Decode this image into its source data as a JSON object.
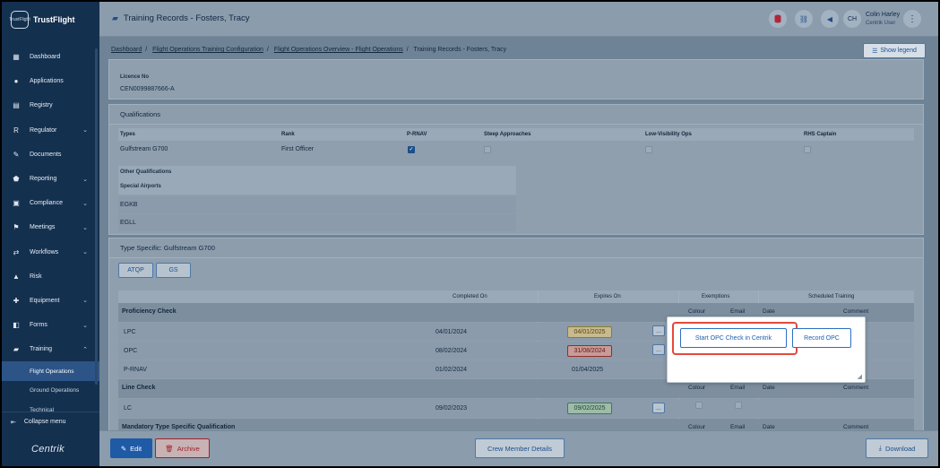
{
  "brand": {
    "name": "TrustFlight",
    "logo_text": "TrustFlight"
  },
  "sidebar": {
    "items": [
      {
        "label": "Dashboard",
        "icon": "dashboard-icon",
        "glyph": "▦",
        "chevron": false
      },
      {
        "label": "Applications",
        "icon": "user-icon",
        "glyph": "●",
        "chevron": false
      },
      {
        "label": "Registry",
        "icon": "book-icon",
        "glyph": "▤",
        "chevron": false
      },
      {
        "label": "Regulator",
        "icon": "regulator-icon",
        "glyph": "R",
        "chevron": true
      },
      {
        "label": "Documents",
        "icon": "paperclip-icon",
        "glyph": "✎",
        "chevron": false
      },
      {
        "label": "Reporting",
        "icon": "shield-icon",
        "glyph": "⬟",
        "chevron": true
      },
      {
        "label": "Compliance",
        "icon": "clipboard-icon",
        "glyph": "▣",
        "chevron": true
      },
      {
        "label": "Meetings",
        "icon": "meetings-icon",
        "glyph": "⚑",
        "chevron": true
      },
      {
        "label": "Workflows",
        "icon": "workflow-icon",
        "glyph": "⇄",
        "chevron": true
      },
      {
        "label": "Risk",
        "icon": "warning-icon",
        "glyph": "▲",
        "chevron": false
      },
      {
        "label": "Equipment",
        "icon": "wrench-icon",
        "glyph": "✚",
        "chevron": true
      },
      {
        "label": "Forms",
        "icon": "forms-icon",
        "glyph": "◧",
        "chevron": true
      },
      {
        "label": "Training",
        "icon": "graduation-cap-icon",
        "glyph": "▰",
        "chevron": true,
        "expanded": true
      }
    ],
    "sub_items": [
      {
        "label": "Flight Operations",
        "active": true
      },
      {
        "label": "Ground Operations",
        "active": false
      },
      {
        "label": "Technical",
        "active": false
      }
    ],
    "collapse_label": "Collapse menu",
    "footer_logo": "Centrik"
  },
  "header": {
    "title": "Training Records - Fosters, Tracy",
    "user": {
      "initials": "CH",
      "name": "Colin Harley",
      "role": "Centrik User"
    }
  },
  "breadcrumb": {
    "items": [
      "Dashboard",
      "Flight Operations Training Configuration",
      "Flight Operations Overview - Flight Operations"
    ],
    "current": "Training Records - Fosters, Tracy"
  },
  "legend_button": "Show legend",
  "licence": {
    "label": "Licence No",
    "value": "CEN0099887666-A"
  },
  "qualifications": {
    "title": "Qualifications",
    "columns": [
      "Types",
      "Rank",
      "P-RNAV",
      "Steep Approaches",
      "Low-Visibility Ops",
      "RHS Captain"
    ],
    "row": {
      "type": "Gulfstream G700",
      "rank": "First Officer",
      "p_rnav": true,
      "steep": false,
      "low_vis": false,
      "rhs": false
    },
    "other_label": "Other Qualifications",
    "special_label": "Special Airports",
    "airports": [
      "EGKB",
      "EGLL"
    ]
  },
  "type_specific": {
    "title": "Type Specific: Gulfstream G700",
    "tabs": [
      "ATQP",
      "GS"
    ],
    "columns": {
      "completed": "Completed On",
      "expires": "Expires On",
      "exemptions": "Exemptions",
      "scheduled": "Scheduled Training"
    },
    "sub_columns": {
      "colour": "Colour",
      "email": "Email",
      "date": "Date",
      "comment": "Comment"
    },
    "sections": [
      {
        "name": "Proficiency Check",
        "rows": [
          {
            "name": "LPC",
            "completed": "04/01/2024",
            "expires": "04/01/2025",
            "status": "amber"
          },
          {
            "name": "OPC",
            "completed": "08/02/2024",
            "expires": "31/08/2024",
            "status": "red"
          },
          {
            "name": "P-RNAV",
            "completed": "01/02/2024",
            "expires": "01/04/2025",
            "status": "none"
          }
        ]
      },
      {
        "name": "Line Check",
        "rows": [
          {
            "name": "LC",
            "completed": "09/02/2023",
            "expires": "09/02/2025",
            "status": "green"
          }
        ]
      },
      {
        "name": "Mandatory Type Specific Qualification",
        "rows": []
      }
    ],
    "more_button": "..."
  },
  "popover": {
    "start_opc": "Start OPC Check in Centrik",
    "record_opc": "Record OPC"
  },
  "footer": {
    "edit": "Edit",
    "archive": "Archive",
    "crew": "Crew Member Details",
    "download": "Download"
  },
  "colors": {
    "sidebar_bg": "#14304f",
    "accent": "#1e5aa6",
    "highlight": "#e24a3b",
    "danger": "#a3202a"
  }
}
